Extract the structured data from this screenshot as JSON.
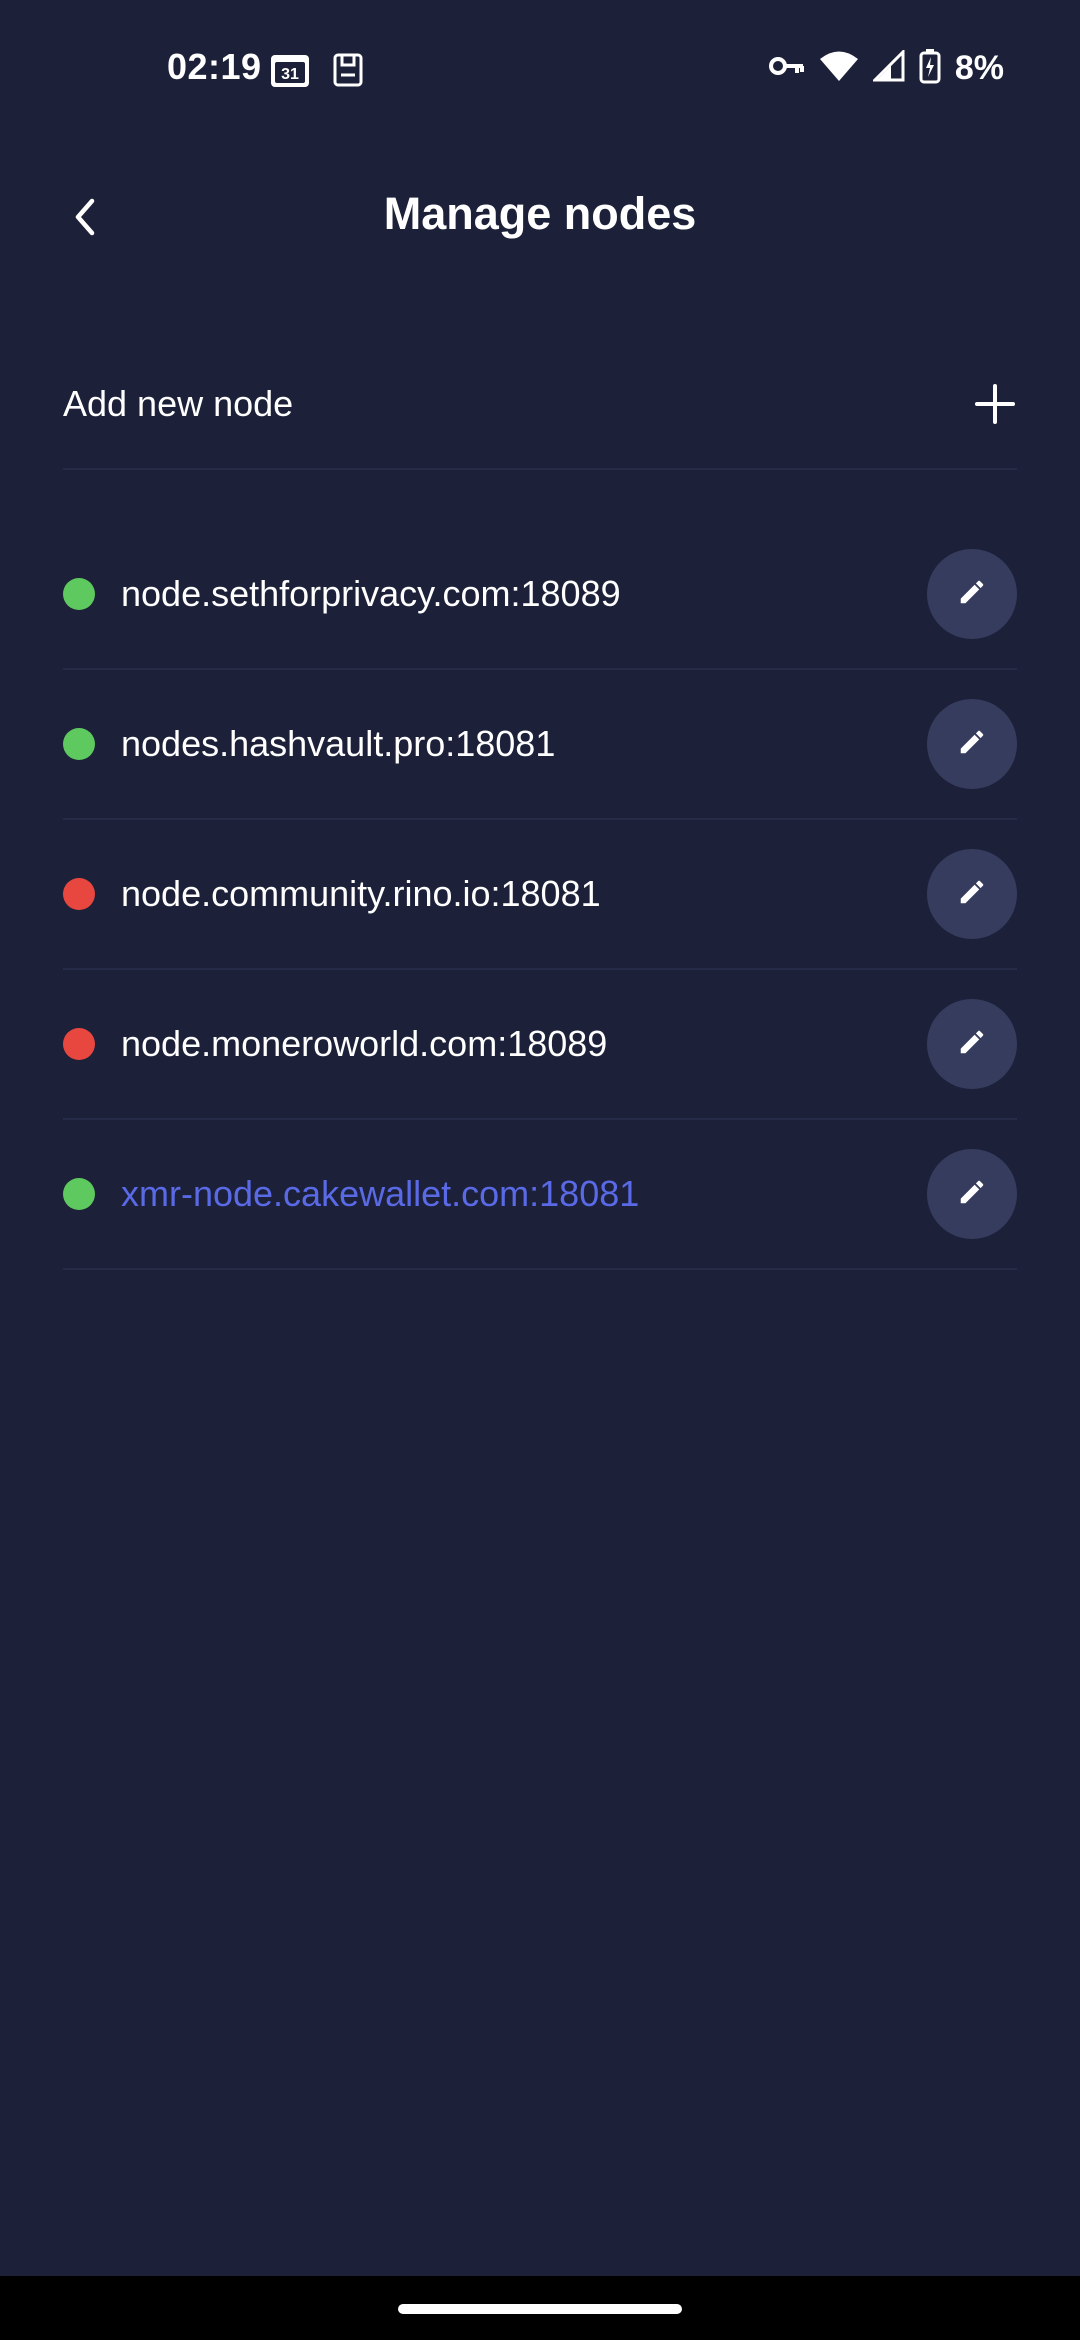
{
  "status_bar": {
    "time": "02:19",
    "calendar_day": "31",
    "battery": "8%"
  },
  "header": {
    "title": "Manage nodes",
    "back_icon": "chevron-left-icon"
  },
  "add_node": {
    "label": "Add new node",
    "icon": "plus-icon"
  },
  "colors": {
    "background": "#1c2139",
    "online": "#5ec95e",
    "offline": "#e8473f",
    "selected_text": "#5a6ae6",
    "edit_button_bg": "#353c5e"
  },
  "nodes": [
    {
      "address": "node.sethforprivacy.com:18089",
      "status": "online",
      "selected": false
    },
    {
      "address": "nodes.hashvault.pro:18081",
      "status": "online",
      "selected": false
    },
    {
      "address": "node.community.rino.io:18081",
      "status": "offline",
      "selected": false
    },
    {
      "address": "node.moneroworld.com:18089",
      "status": "offline",
      "selected": false
    },
    {
      "address": "xmr-node.cakewallet.com:18081",
      "status": "online",
      "selected": true
    }
  ]
}
